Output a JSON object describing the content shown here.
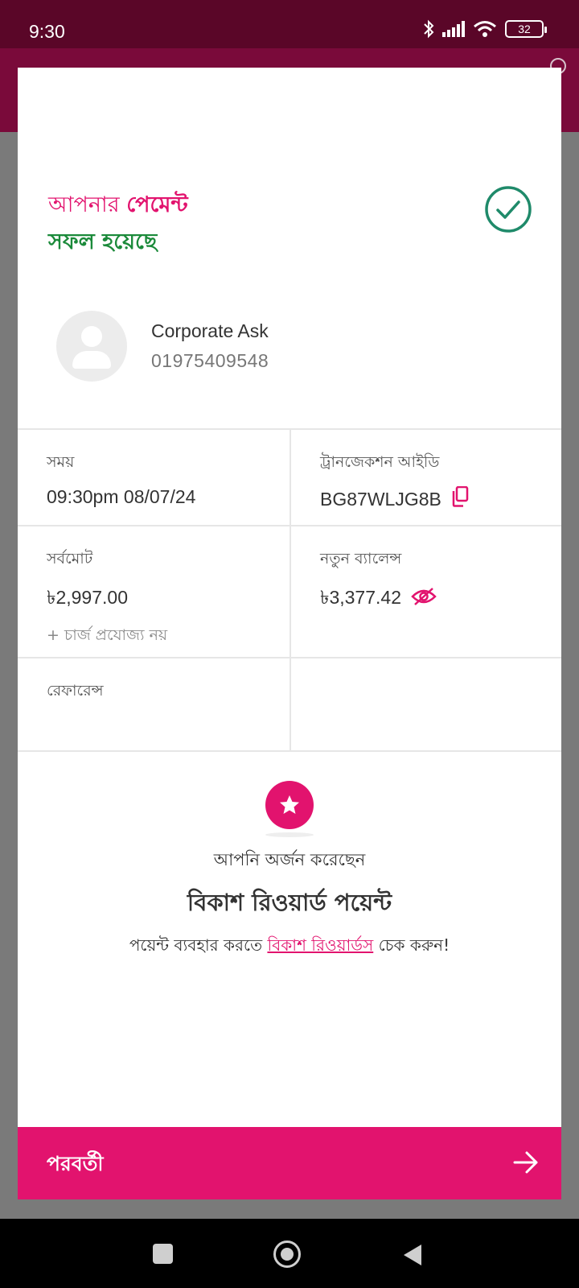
{
  "status_bar": {
    "time": "9:30",
    "battery": "32"
  },
  "success": {
    "line1_prefix": "আপনার ",
    "line1_bold": "পেমেন্ট",
    "line2": "সফল হয়েছে"
  },
  "recipient": {
    "name": "Corporate Ask",
    "number": "01975409548"
  },
  "details": {
    "time_label": "সময়",
    "time_value": "09:30pm 08/07/24",
    "trx_label": "ট্রানজেকশন আইডি",
    "trx_value": "BG87WLJG8B",
    "total_label": "সর্বমোট",
    "total_value": "৳2,997.00",
    "total_note": "+ চার্জ প্রযোজ্য নয়",
    "balance_label": "নতুন ব্যালেন্স",
    "balance_value": "৳3,377.42",
    "reference_label": "রেফারেন্স"
  },
  "reward": {
    "earned": "আপনি অর্জন করেছেন",
    "title": "বিকাশ রিওয়ার্ড পয়েন্ট",
    "note_prefix": "পয়েন্ট ব্যবহার করতে ",
    "note_link": "বিকাশ রিওয়ার্ডস",
    "note_suffix": " চেক করুন!"
  },
  "next": {
    "label": "পরবর্তী"
  },
  "colors": {
    "brand_pink": "#e2136e",
    "success_green": "#1b8a3a",
    "check_teal": "#1f8a6a"
  }
}
